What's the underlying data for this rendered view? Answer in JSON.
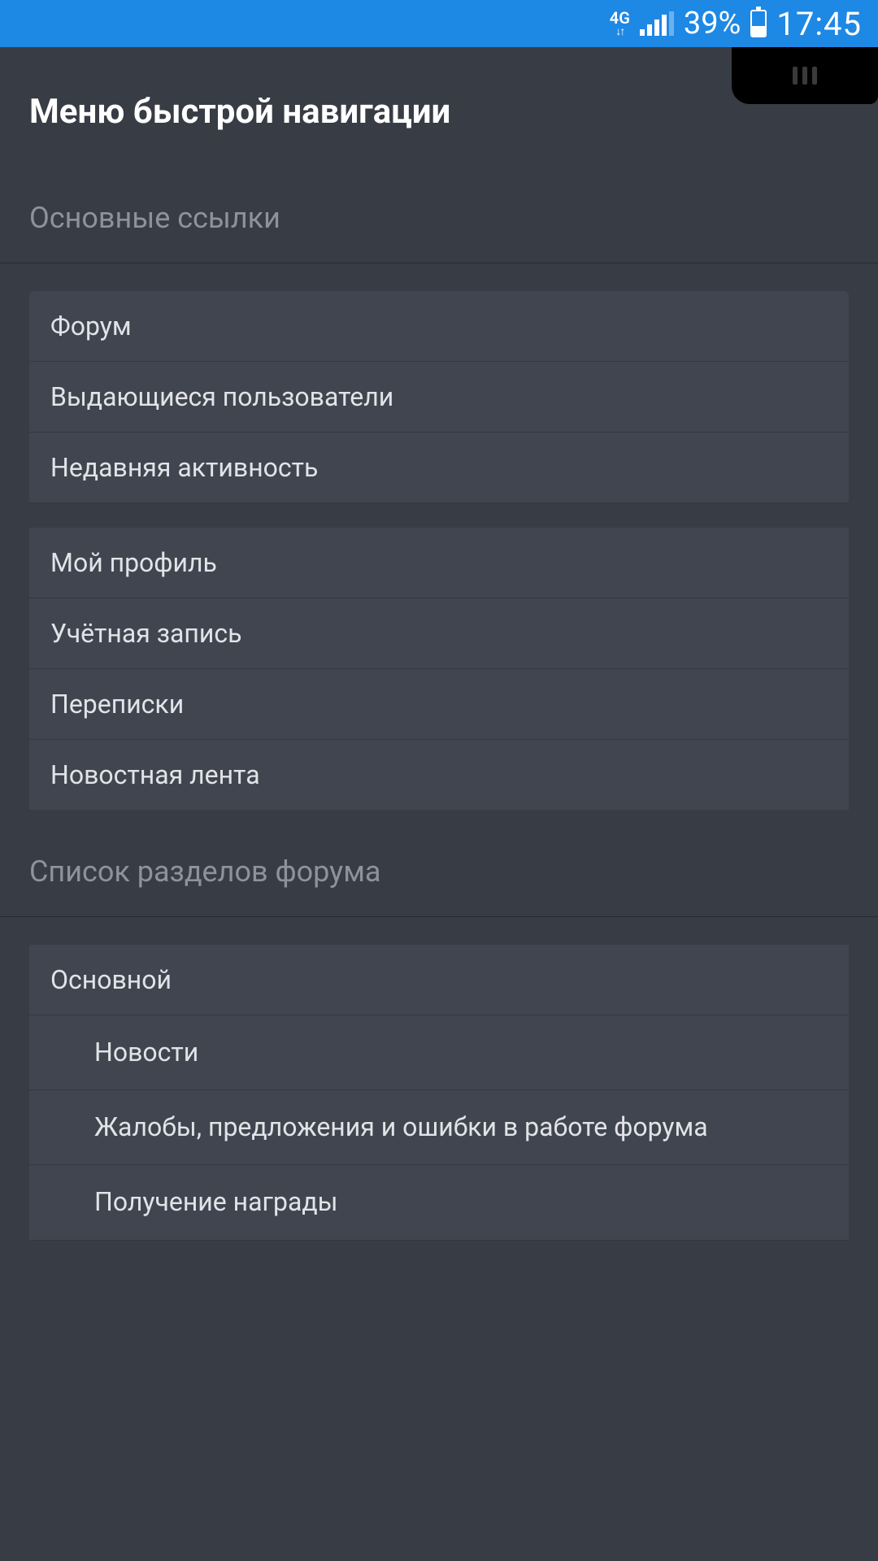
{
  "status_bar": {
    "network_type": "4G",
    "battery_pct": "39%",
    "time": "17:45"
  },
  "page": {
    "title": "Меню быстрой навигации"
  },
  "sections": {
    "main_links": {
      "header": "Основные ссылки",
      "group1": [
        "Форум",
        "Выдающиеся пользователи",
        "Недавняя активность"
      ],
      "group2": [
        "Мой профиль",
        "Учётная запись",
        "Переписки",
        "Новостная лента"
      ]
    },
    "forum_sections": {
      "header": "Список разделов форума",
      "category": "Основной",
      "subs": [
        "Новости",
        "Жалобы, предложения и ошибки в работе форума",
        "Получение награды"
      ]
    }
  }
}
